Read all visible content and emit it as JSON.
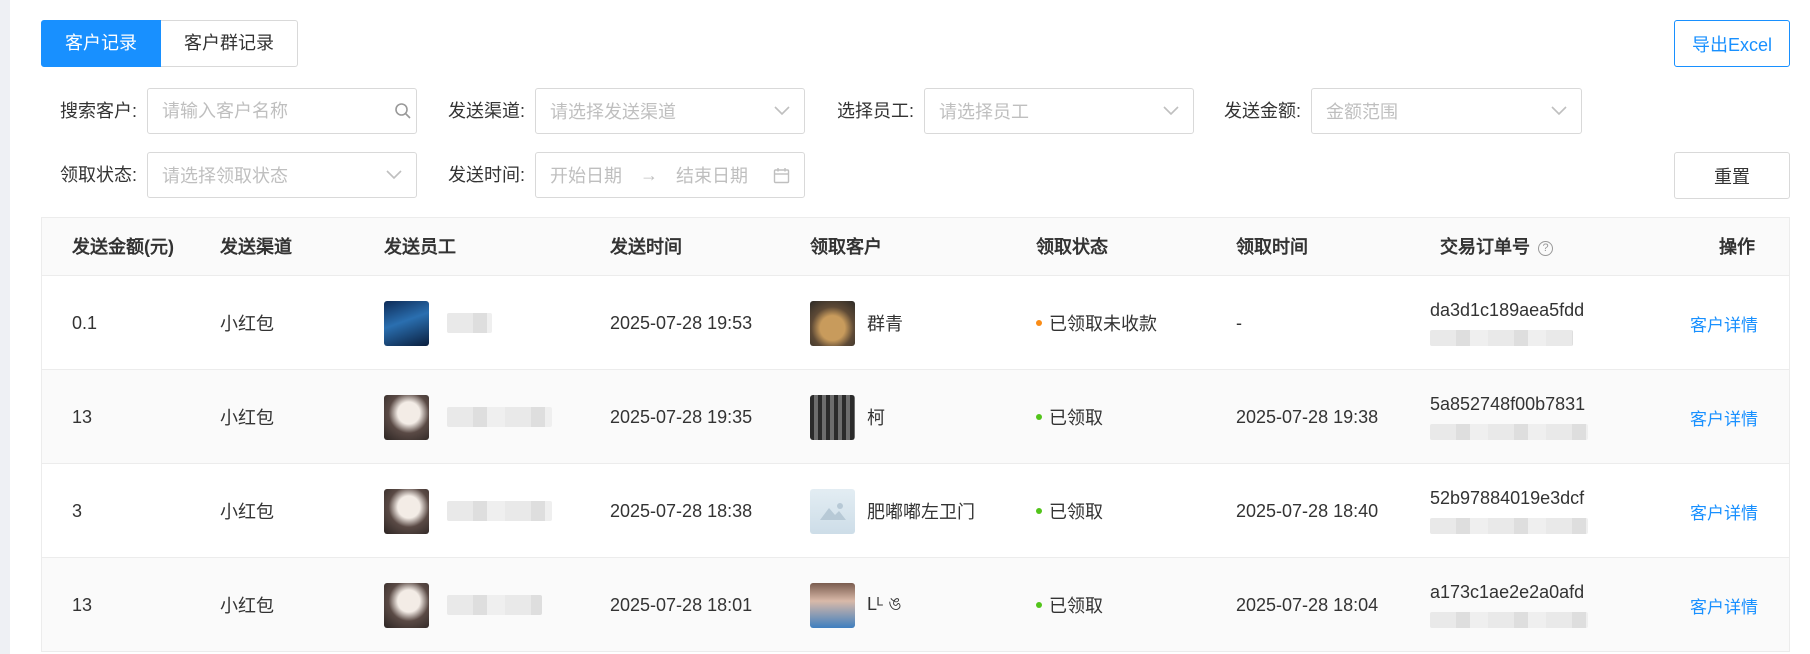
{
  "tabs": [
    {
      "label": "客户记录",
      "active": true
    },
    {
      "label": "客户群记录",
      "active": false
    }
  ],
  "buttons": {
    "export": "导出Excel",
    "reset": "重置"
  },
  "filters": {
    "customer": {
      "label": "搜索客户:",
      "placeholder": "请输入客户名称",
      "icon": "search-icon"
    },
    "channel": {
      "label": "发送渠道:",
      "placeholder": "请选择发送渠道"
    },
    "staff": {
      "label": "选择员工:",
      "placeholder": "请选择员工"
    },
    "amount": {
      "label": "发送金额:",
      "placeholder": "金额范围"
    },
    "status": {
      "label": "领取状态:",
      "placeholder": "请选择领取状态"
    },
    "time": {
      "label": "发送时间:",
      "start_placeholder": "开始日期",
      "end_placeholder": "结束日期",
      "icon": "calendar-icon"
    }
  },
  "table": {
    "columns": [
      "发送金额(元)",
      "发送渠道",
      "发送员工",
      "发送时间",
      "领取客户",
      "领取状态",
      "领取时间",
      "交易订单号",
      "操作"
    ],
    "rows": [
      {
        "amount": "0.1",
        "channel": "小红包",
        "send_time": "2025-07-28 19:53",
        "customer": "群青",
        "status": "已领取未收款",
        "status_color": "#fa8c16",
        "receive_time": "-",
        "order_no": "da3d1c189aea5fdd",
        "action": "客户详情"
      },
      {
        "amount": "13",
        "channel": "小红包",
        "send_time": "2025-07-28 19:35",
        "customer": "柯",
        "status": "已领取",
        "status_color": "#52c41a",
        "receive_time": "2025-07-28 19:38",
        "order_no": "5a852748f00b7831",
        "action": "客户详情"
      },
      {
        "amount": "3",
        "channel": "小红包",
        "send_time": "2025-07-28 18:38",
        "customer": "肥嘟嘟左卫门",
        "status": "已领取",
        "status_color": "#52c41a",
        "receive_time": "2025-07-28 18:40",
        "order_no": "52b97884019e3dcf",
        "action": "客户详情"
      },
      {
        "amount": "13",
        "channel": "小红包",
        "send_time": "2025-07-28 18:01",
        "customer": "Lᴸ ঙ",
        "status": "已领取",
        "status_color": "#52c41a",
        "receive_time": "2025-07-28 18:04",
        "order_no": "a173c1ae2e2a0afd",
        "action": "客户详情"
      }
    ]
  },
  "colors": {
    "primary": "#1890ff",
    "success": "#52c41a",
    "warning": "#fa8c16"
  }
}
